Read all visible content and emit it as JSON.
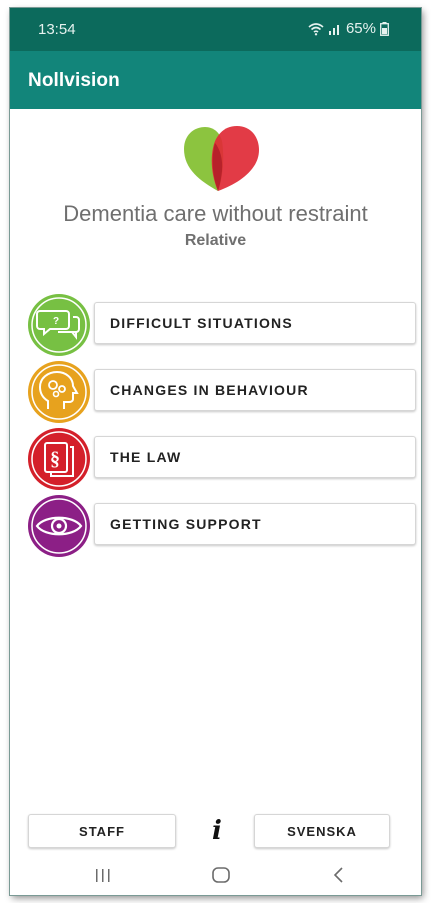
{
  "status_bar": {
    "time": "13:54",
    "battery": "65%"
  },
  "app_bar": {
    "title": "Nollvision"
  },
  "header": {
    "headline": "Dementia care without restraint",
    "subheadline": "Relative"
  },
  "menu": [
    {
      "label": "DIFFICULT SITUATIONS",
      "icon": "speech-bubbles-icon",
      "color": "#77c043"
    },
    {
      "label": "CHANGES IN BEHAVIOUR",
      "icon": "head-gears-icon",
      "color": "#e7a21e"
    },
    {
      "label": "THE LAW",
      "icon": "law-document-icon",
      "color": "#d4202a"
    },
    {
      "label": "GETTING SUPPORT",
      "icon": "eye-icon",
      "color": "#8c1f86"
    }
  ],
  "bottom": {
    "staff_label": "STAFF",
    "info_glyph": "i",
    "language_label": "SVENSKA"
  },
  "colors": {
    "status_bar": "#0c6a5c",
    "app_bar": "#12857a",
    "logo_green": "#8cc43f",
    "logo_red": "#e02a36"
  }
}
